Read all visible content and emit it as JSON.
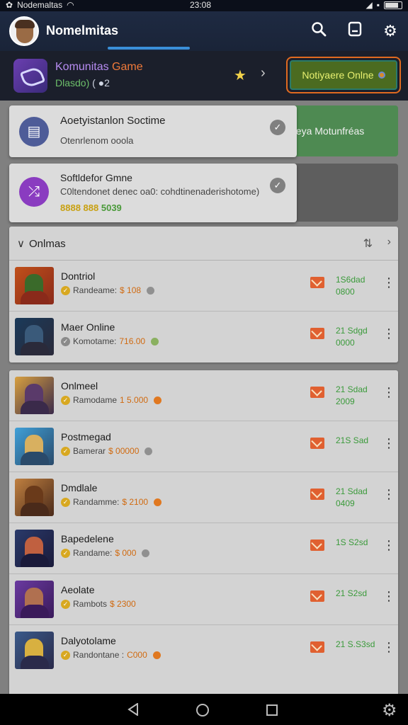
{
  "status": {
    "carrier": "Nodemaltas",
    "time": "23:08"
  },
  "appbar": {
    "title": "Nomelmitas",
    "icons": [
      "search-icon",
      "save-icon",
      "settings-icon"
    ]
  },
  "featured": {
    "title_a": "Komunitas",
    "title_b": "Game",
    "sub": "Dlasdo)",
    "count": "2",
    "notify_label": "Notiyaere Onlne"
  },
  "suggestions": {
    "green_text": "neya Motunfréas",
    "card1": {
      "title": "Aoetyistanlon Soctime",
      "sub": "Otenrlenom ooola"
    },
    "card2": {
      "title": "Softldefor Gmne",
      "sub": "C0ltendonet denec oa0: cohdtinenaderishotome)",
      "extra_a": "8888 888",
      "extra_b": "5039"
    }
  },
  "panel1": {
    "title": "Onlmas",
    "rows": [
      {
        "title": "Dontriol",
        "sub": "Randeame:",
        "price": "$ 108",
        "stat1": "1S6dad",
        "stat2": "0800",
        "tail": "grey",
        "badge": "gold"
      },
      {
        "title": "Maer Online",
        "sub": "Komotame:",
        "price": "716.00",
        "stat1": "21 Sdgd",
        "stat2": "0000",
        "tail": "green",
        "badge": "grey"
      }
    ]
  },
  "panel2": {
    "rows": [
      {
        "title": "Onlmeel",
        "sub": "Ramodame",
        "price": "1 5.000",
        "stat1": "21 Sdad",
        "stat2": "2009",
        "tail": "orange",
        "badge": "gold"
      },
      {
        "title": "Postmegad",
        "sub": "Bamerar",
        "price": "$ 00000",
        "stat1": "21S Sad",
        "stat2": "",
        "tail": "grey",
        "badge": "gold"
      },
      {
        "title": "Dmdlale",
        "sub": "Randamme:",
        "price": "$ 2100",
        "stat1": "21 Sdad",
        "stat2": "0409",
        "tail": "orange",
        "badge": "gold"
      },
      {
        "title": "Bapedelene",
        "sub": "Randame:",
        "price": "$ 000",
        "stat1": "1S S2sd",
        "stat2": "",
        "tail": "grey",
        "badge": "gold"
      },
      {
        "title": "Aeolate",
        "sub": "Rambots",
        "price": "$ 2300",
        "stat1": "21 S2sd",
        "stat2": "",
        "tail": "none",
        "badge": "gold"
      },
      {
        "title": "Dalyotolame",
        "sub": "Randontane :",
        "price": "C000",
        "stat1": "21 S.S3sd",
        "stat2": "",
        "tail": "orange",
        "badge": "gold"
      }
    ]
  },
  "colors": {
    "appbar": "#1e2a42",
    "accent_blue": "#3a8fd8",
    "notify_border": "#e06a20",
    "stat_green": "#3a9a3a",
    "price_orange": "#d06a10"
  }
}
